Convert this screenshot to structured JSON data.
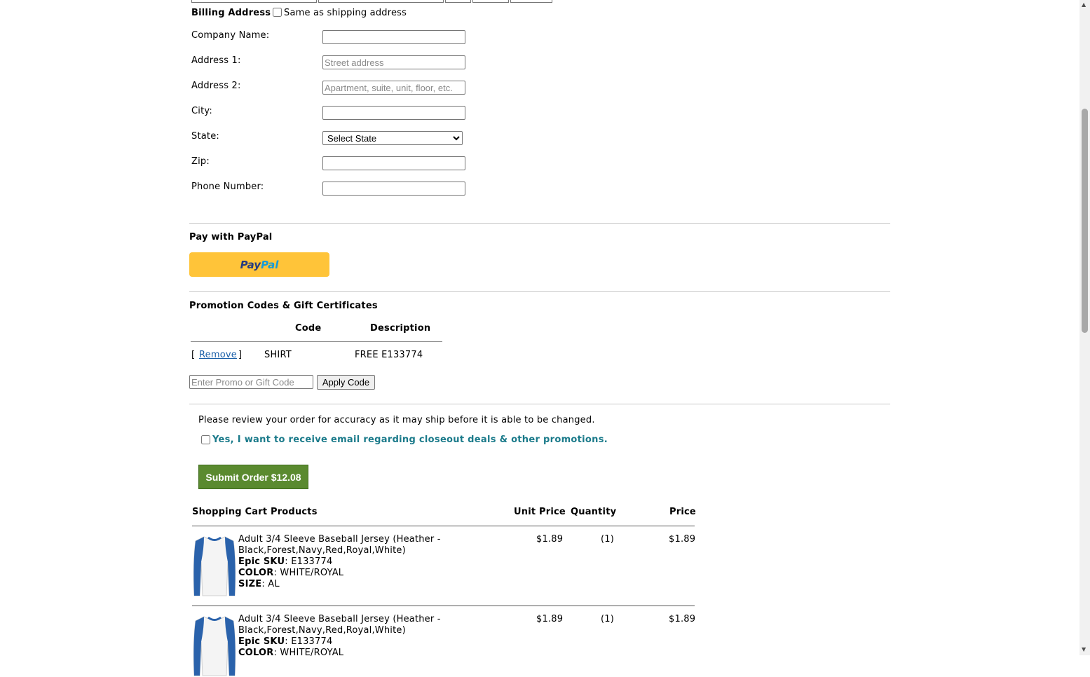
{
  "billing": {
    "title": "Billing Address",
    "same_as_shipping": "Same as shipping address",
    "fields": {
      "company_label": "Company Name:",
      "address1_label": "Address 1:",
      "address1_placeholder": "Street address",
      "address2_label": "Address 2:",
      "address2_placeholder": "Apartment, suite, unit, floor, etc.",
      "city_label": "City:",
      "state_label": "State:",
      "state_selected": "Select State",
      "zip_label": "Zip:",
      "phone_label": "Phone Number:"
    }
  },
  "paypal": {
    "title": "Pay with PayPal",
    "button_pay": "Pay",
    "button_pal": "Pal"
  },
  "promo": {
    "title": "Promotion Codes & Gift Certificates",
    "headers": {
      "code": "Code",
      "description": "Description"
    },
    "rows": [
      {
        "remove_open": "[",
        "remove_label": "Remove",
        "remove_close": "]",
        "code": "SHIRT",
        "description": "FREE E133774"
      }
    ],
    "input_placeholder": "Enter Promo or Gift Code",
    "apply_label": "Apply Code"
  },
  "review": {
    "notice": "Please review your order for accuracy as it may ship before it is able to be changed.",
    "email_optin": "Yes, I want to receive email regarding closeout deals & other promotions.",
    "submit_label": "Submit Order $12.08"
  },
  "cart": {
    "headers": {
      "products": "Shopping Cart Products",
      "unit_price": "Unit Price",
      "quantity": "Quantity",
      "price": "Price"
    },
    "items": [
      {
        "name_line1": "Adult 3/4 Sleeve Baseball Jersey (Heather -",
        "name_line2": "Black,Forest,Navy,Red,Royal,White)",
        "sku_label": "Epic SKU",
        "sku": "E133774",
        "color_label": "COLOR",
        "color": "WHITE/ROYAL",
        "size_label": "SIZE",
        "size": "AL",
        "unit_price": "$1.89",
        "quantity": "(1)",
        "price": "$1.89"
      },
      {
        "name_line1": "Adult 3/4 Sleeve Baseball Jersey (Heather -",
        "name_line2": "Black,Forest,Navy,Red,Royal,White)",
        "sku_label": "Epic SKU",
        "sku": "E133774",
        "color_label": "COLOR",
        "color": "WHITE/ROYAL",
        "unit_price": "$1.89",
        "quantity": "(1)",
        "price": "$1.89"
      }
    ],
    "colon": ":"
  },
  "colors": {
    "paypal_yellow": "#ffc439",
    "submit_green": "#5a8a2f",
    "optin_teal": "#1a7a8a",
    "link_blue": "#1a5fa8",
    "jersey_sleeve": "#2a62ab"
  }
}
